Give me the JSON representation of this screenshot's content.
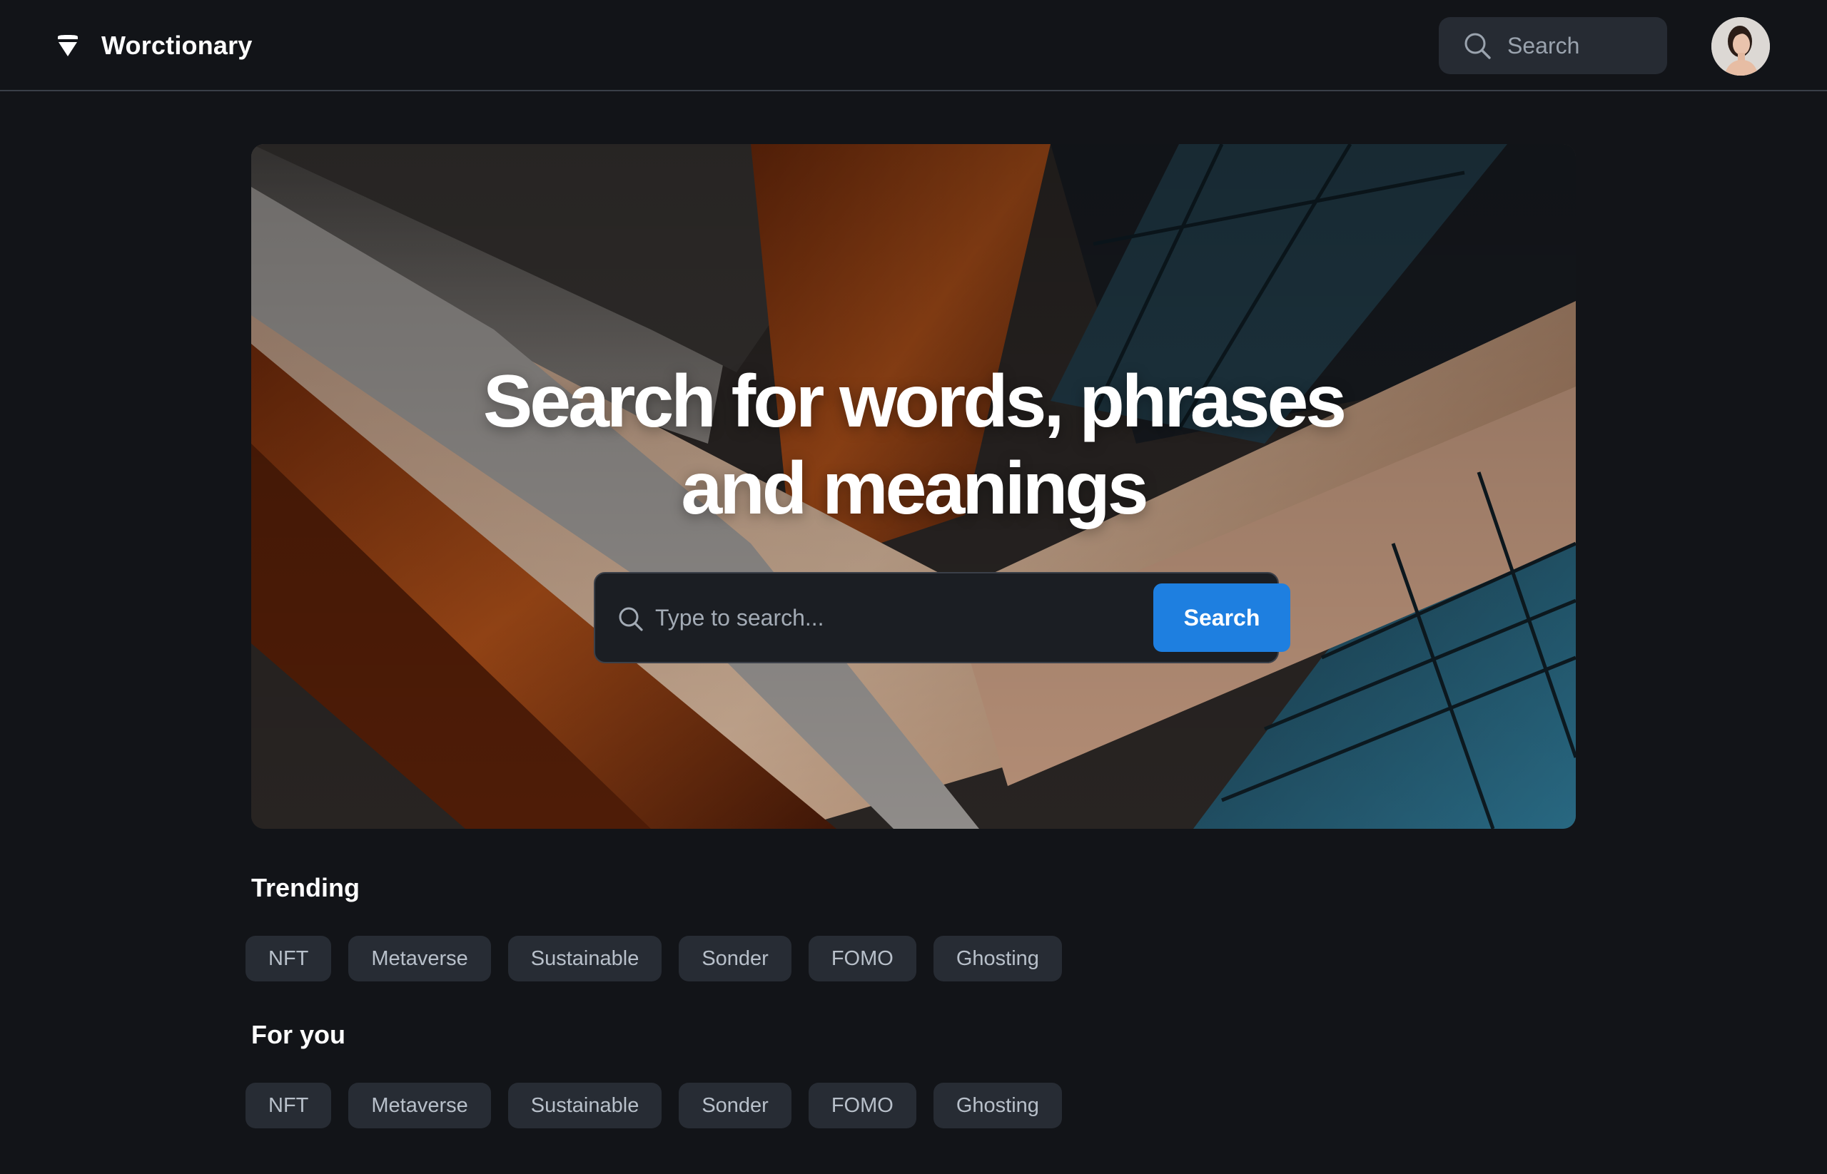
{
  "header": {
    "brand_name": "Worctionary",
    "logo_icon": "brand-logo-icon",
    "search_placeholder": "Search",
    "avatar_icon": "user-avatar"
  },
  "hero": {
    "title": "Search for words, phrases and meanings",
    "search_placeholder": "Type to search...",
    "search_button_label": "Search"
  },
  "trending": {
    "title": "Trending",
    "chips": [
      "NFT",
      "Metaverse",
      "Sustainable",
      "Sonder",
      "FOMO",
      "Ghosting"
    ]
  },
  "for_you": {
    "title": "For you",
    "chips": [
      "NFT",
      "Metaverse",
      "Sustainable",
      "Sonder",
      "FOMO",
      "Ghosting"
    ]
  },
  "colors": {
    "background": "#121418",
    "accent": "#1e7fe0",
    "chip_bg": "#272c34",
    "chip_text": "#b8c0ca"
  }
}
